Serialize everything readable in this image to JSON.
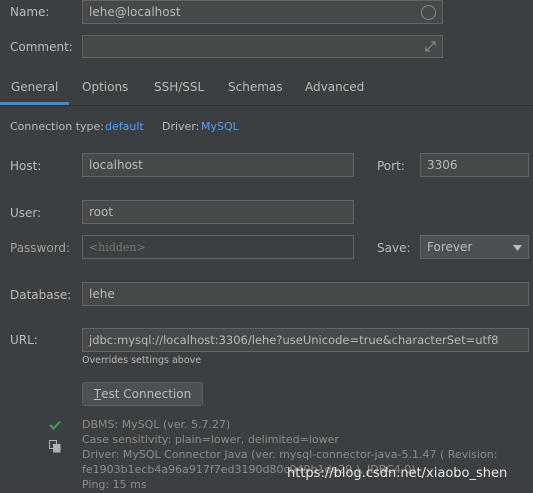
{
  "form": {
    "name_label": "Name:",
    "name_value": "lehe@localhost",
    "comment_label": "Comment:",
    "comment_value": ""
  },
  "tabs": [
    {
      "label": "General",
      "active": true
    },
    {
      "label": "Options"
    },
    {
      "label": "SSH/SSL"
    },
    {
      "label": "Schemas"
    },
    {
      "label": "Advanced"
    }
  ],
  "connection": {
    "type_label": "Connection type:",
    "type_value": "default",
    "driver_label": "Driver:",
    "driver_value": "MySQL"
  },
  "fields": {
    "host_label": "Host:",
    "host_value": "localhost",
    "port_label": "Port:",
    "port_value": "3306",
    "user_label": "User:",
    "user_value": "root",
    "password_label": "Password:",
    "password_value": "<hidden>",
    "save_label": "Save:",
    "save_value": "Forever",
    "database_label": "Database:",
    "database_value": "lehe",
    "url_label": "URL:",
    "url_value": "jdbc:mysql://localhost:3306/lehe?useUnicode=true&characterSet=utf8",
    "url_hint": "Overrides settings above"
  },
  "test_button": {
    "mnemonic": "T",
    "rest": "est Connection"
  },
  "results": {
    "dbms": "DBMS: MySQL (ver. 5.7.27)",
    "case_sensitivity": "Case sensitivity: plain=lower, delimited=lower",
    "driver": "Driver: MySQL Connector Java (ver. mysql-connector-java-5.1.47 ( Revision:",
    "revision": "fe1903b1ecb4a96a917f7ed3190d80c049b1de29 ), JDBC4.0)",
    "ping": "Ping: 15 ms"
  },
  "watermark": "https://blog.csdn.net/xiaobo_shen",
  "colors": {
    "background": "#3c3f41",
    "accent": "#4a88c7",
    "link": "#589df6",
    "success": "#499c54"
  }
}
